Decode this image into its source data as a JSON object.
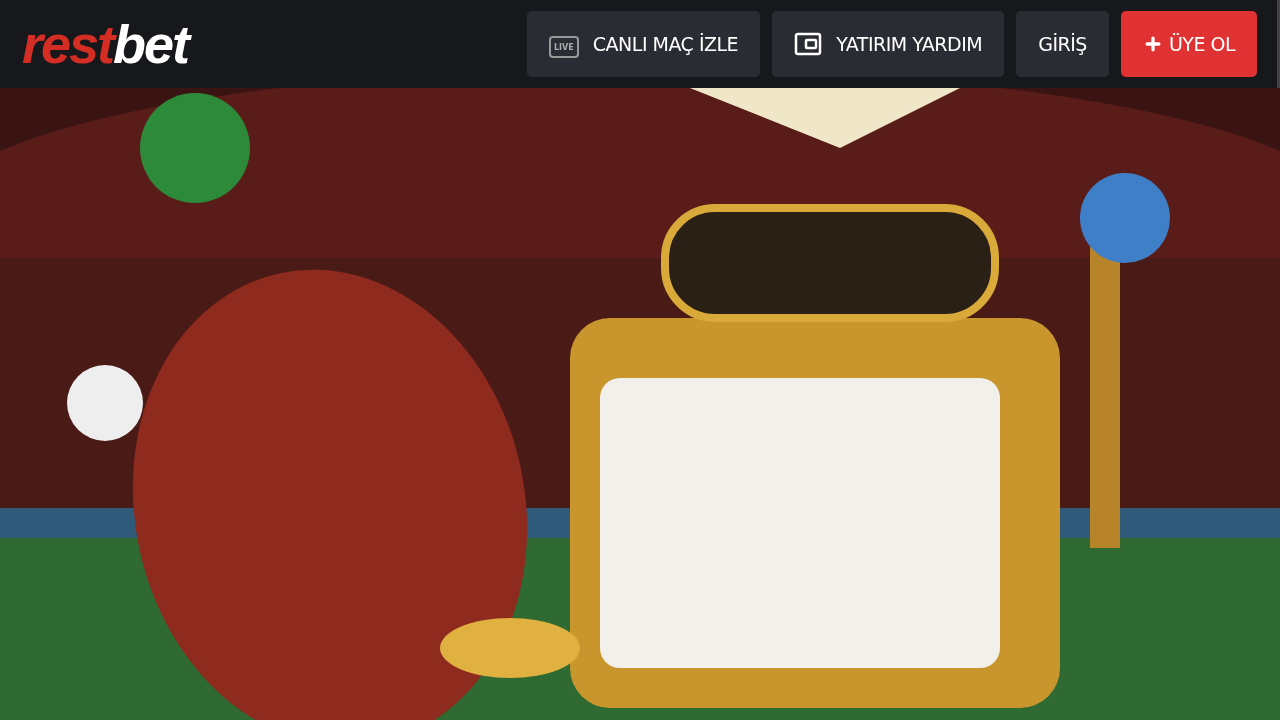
{
  "header": {
    "logo": {
      "first": "rest",
      "second": "bet"
    },
    "nav": [
      {
        "kind": "live",
        "label": "CANLI MAÇ İZLE",
        "icon_text": "LIVE"
      },
      {
        "kind": "wallet",
        "label": "YATIRIM YARDIM"
      },
      {
        "kind": "plain",
        "label": "GİRİŞ"
      },
      {
        "kind": "primary",
        "label": "ÜYE OL"
      }
    ]
  }
}
